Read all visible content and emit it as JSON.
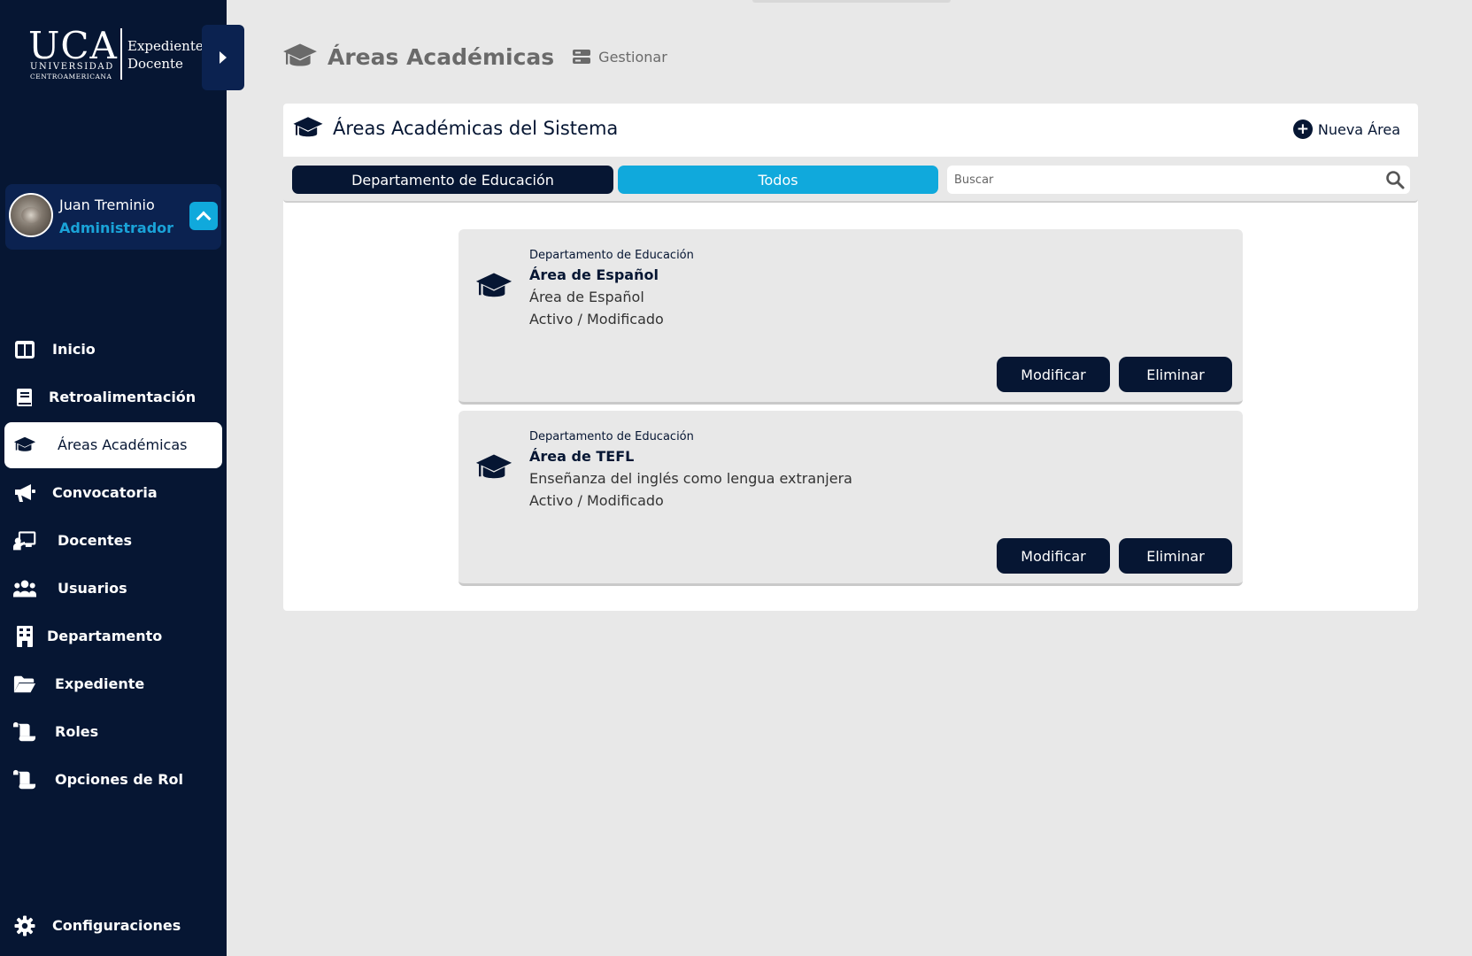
{
  "brand": {
    "logo_main": "UCA",
    "logo_sub1": "UNIVERSIDAD",
    "logo_sub2": "CENTROAMERICANA",
    "product_line1": "Expediente",
    "product_line2": "Docente"
  },
  "user": {
    "name": "Juan Treminio",
    "role": "Administrador"
  },
  "sidebar": {
    "items": [
      {
        "label": "Inicio",
        "icon": "home-grid-icon"
      },
      {
        "label": "Retroalimentación",
        "icon": "book-icon"
      },
      {
        "label": "Áreas Académicas",
        "icon": "graduation-cap-icon",
        "active": true
      },
      {
        "label": "Convocatoria",
        "icon": "megaphone-icon"
      },
      {
        "label": "Docentes",
        "icon": "teacher-board-icon"
      },
      {
        "label": "Usuarios",
        "icon": "users-icon"
      },
      {
        "label": "Departamento",
        "icon": "building-icon"
      },
      {
        "label": "Expediente",
        "icon": "folder-open-icon"
      },
      {
        "label": "Roles",
        "icon": "scroll-icon"
      },
      {
        "label": "Opciones de Rol",
        "icon": "scroll-icon"
      }
    ],
    "config_label": "Configuraciones"
  },
  "header": {
    "title": "Áreas Académicas",
    "manage_label": "Gestionar"
  },
  "panel": {
    "title": "Áreas Académicas del Sistema",
    "new_button": "Nueva Área",
    "filters": {
      "department": "Departamento de Educación",
      "all": "Todos"
    },
    "search_placeholder": "Buscar"
  },
  "areas": [
    {
      "department": "Departamento de Educación",
      "name": "Área de Español",
      "description": "Área de Español",
      "status": "Activo / Modificado",
      "modify_label": "Modificar",
      "delete_label": "Eliminar"
    },
    {
      "department": "Departamento de Educación",
      "name": "Área de TEFL",
      "description": "Enseñanza del inglés como lengua extranjera",
      "status": "Activo / Modificado",
      "modify_label": "Modificar",
      "delete_label": "Eliminar"
    }
  ],
  "colors": {
    "navy": "#061633",
    "navy_light": "#0b2250",
    "accent": "#10a9dc",
    "background": "#e8e8e8"
  }
}
